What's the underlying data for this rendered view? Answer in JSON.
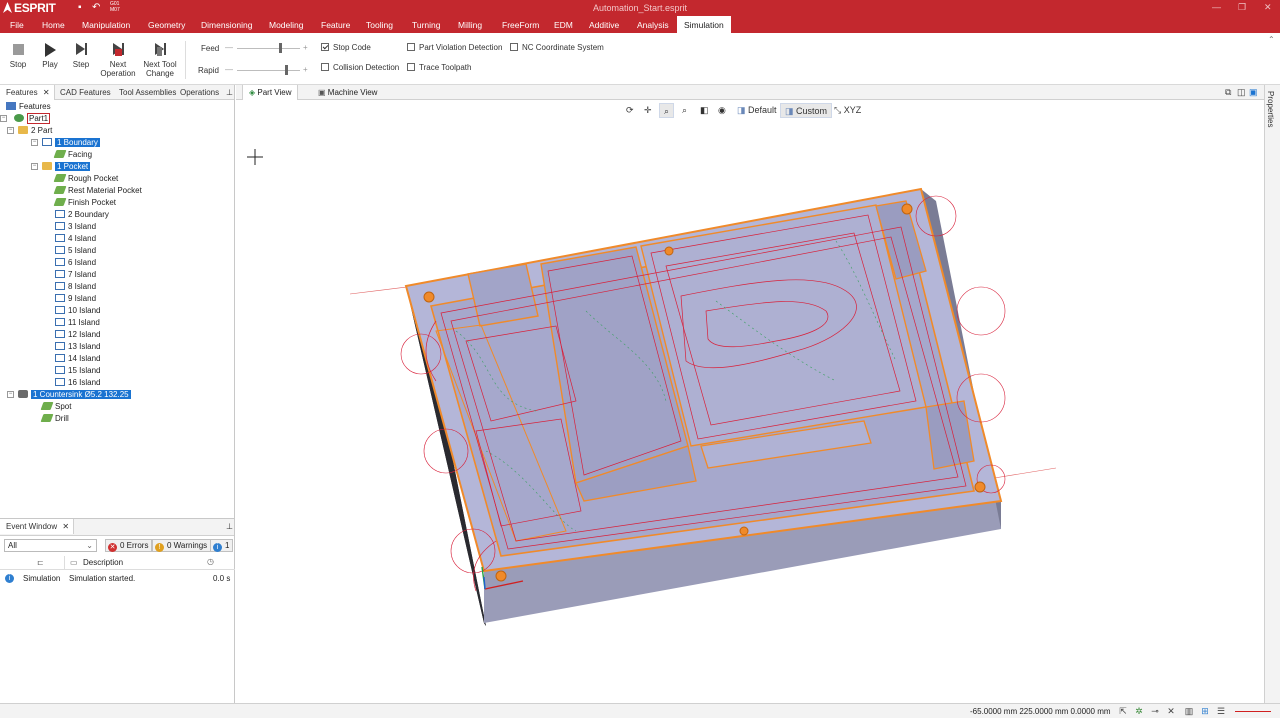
{
  "app": {
    "name": "ESPRIT",
    "document_title": "Automation_Start.esprit",
    "gcode_badge": [
      "G01",
      "M07"
    ]
  },
  "menu": [
    "File",
    "Home",
    "Manipulation",
    "Geometry",
    "Dimensioning",
    "Modeling",
    "Feature",
    "Tooling",
    "Turning",
    "Milling",
    "FreeForm",
    "EDM",
    "Additive",
    "Analysis",
    "Simulation"
  ],
  "active_menu": "Simulation",
  "ribbon": {
    "buttons": [
      {
        "label": "Stop"
      },
      {
        "label": "Play"
      },
      {
        "label": "Step"
      },
      {
        "label": "Next Operation"
      },
      {
        "label": "Next Tool Change"
      }
    ],
    "sliders": [
      {
        "label": "Feed",
        "level": 0.8
      },
      {
        "label": "Rapid",
        "level": 0.9
      }
    ],
    "checks": [
      {
        "label": "Stop Code",
        "checked": true
      },
      {
        "label": "Collision Detection",
        "checked": false
      },
      {
        "label": "Part Violation Detection",
        "checked": false
      },
      {
        "label": "Trace Toolpath",
        "checked": false
      },
      {
        "label": "NC Coordinate System",
        "checked": false
      }
    ]
  },
  "left_tabs": [
    "Features",
    "CAD Features",
    "Tool Assemblies",
    "Operations"
  ],
  "tree": [
    {
      "label": "Features",
      "level": 0,
      "icon": "features-icon"
    },
    {
      "label": "Part1",
      "level": 0,
      "icon": "part-icon",
      "box": true
    },
    {
      "label": "2 Part",
      "level": 1,
      "icon": "folder-icon"
    },
    {
      "label": "1 Boundary",
      "level": 2,
      "icon": "boundary-icon",
      "selected": true
    },
    {
      "label": "Facing",
      "level": 3,
      "icon": "operation-icon"
    },
    {
      "label": "1 Pocket",
      "level": 2,
      "icon": "folder-icon",
      "selected": true
    },
    {
      "label": "Rough Pocket",
      "level": 3,
      "icon": "operation-icon"
    },
    {
      "label": "Rest Material Pocket",
      "level": 3,
      "icon": "operation-icon"
    },
    {
      "label": "Finish Pocket",
      "level": 3,
      "icon": "operation-icon"
    },
    {
      "label": "2 Boundary",
      "level": 3,
      "icon": "boundary-icon"
    },
    {
      "label": "3 Island",
      "level": 3,
      "icon": "boundary-icon"
    },
    {
      "label": "4 Island",
      "level": 3,
      "icon": "boundary-icon"
    },
    {
      "label": "5 Island",
      "level": 3,
      "icon": "boundary-icon"
    },
    {
      "label": "6 Island",
      "level": 3,
      "icon": "boundary-icon"
    },
    {
      "label": "7 Island",
      "level": 3,
      "icon": "boundary-icon"
    },
    {
      "label": "8 Island",
      "level": 3,
      "icon": "boundary-icon"
    },
    {
      "label": "9 Island",
      "level": 3,
      "icon": "boundary-icon"
    },
    {
      "label": "10 Island",
      "level": 3,
      "icon": "boundary-icon"
    },
    {
      "label": "11 Island",
      "level": 3,
      "icon": "boundary-icon"
    },
    {
      "label": "12 Island",
      "level": 3,
      "icon": "boundary-icon"
    },
    {
      "label": "13 Island",
      "level": 3,
      "icon": "boundary-icon"
    },
    {
      "label": "14 Island",
      "level": 3,
      "icon": "boundary-icon"
    },
    {
      "label": "15 Island",
      "level": 3,
      "icon": "boundary-icon"
    },
    {
      "label": "16 Island",
      "level": 3,
      "icon": "boundary-icon"
    },
    {
      "label": "1 Countersink Ø5.2 132.25",
      "level": 1,
      "icon": "countersink-icon",
      "selected": true
    },
    {
      "label": "Spot",
      "level": 2,
      "icon": "operation-icon"
    },
    {
      "label": "Drill",
      "level": 2,
      "icon": "operation-icon"
    }
  ],
  "event_window": {
    "title": "Event Window",
    "filter": "All",
    "errors": "0 Errors",
    "warnings": "0 Warnings",
    "info": "1",
    "columns": [
      "Description"
    ],
    "rows": [
      {
        "source": "Simulation",
        "description": "Simulation started.",
        "time": "0.0 s"
      }
    ]
  },
  "view_tabs": [
    "Part View",
    "Machine View"
  ],
  "view_toolbar": {
    "default_label": "Default",
    "custom_label": "Custom",
    "xyz_label": "XYZ"
  },
  "properties_label": "Properties",
  "status": {
    "coords": "-65.0000 mm  225.0000 mm  0.0000 mm"
  },
  "colors": {
    "brand": "#c3282e",
    "selection": "#1a73d1",
    "part_body": "#b4b6d8",
    "edge": "#f08a2a",
    "toolpath": "#d8203a"
  }
}
